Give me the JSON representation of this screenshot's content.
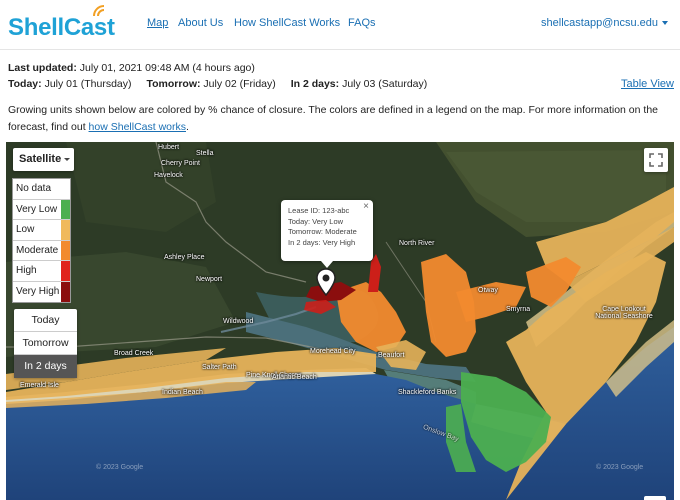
{
  "brand": {
    "name": "ShellCast"
  },
  "nav": {
    "links": [
      "Map",
      "About Us",
      "How ShellCast Works",
      "FAQs"
    ],
    "user": "shellcastapp@ncsu.edu"
  },
  "status": {
    "last_updated_label": "Last updated:",
    "last_updated_value": "July 01, 2021 09:48 AM (4 hours ago)",
    "today_label": "Today:",
    "today_value": "July 01 (Thursday)",
    "tomorrow_label": "Tomorrow:",
    "tomorrow_value": "July 02 (Friday)",
    "in2days_label": "In 2 days:",
    "in2days_value": "July 03 (Saturday)",
    "table_view": "Table View"
  },
  "description": {
    "text": "Growing units shown below are colored by % chance of closure. The colors are defined in a legend on the map. For more information on the forecast, find out ",
    "link": "how ShellCast works",
    "end": "."
  },
  "map": {
    "map_type": "Satellite",
    "legend": [
      {
        "label": "No data",
        "color": "#ffffff"
      },
      {
        "label": "Very Low",
        "color": "#4caf50"
      },
      {
        "label": "Low",
        "color": "#f0b95b"
      },
      {
        "label": "Moderate",
        "color": "#f28a2e"
      },
      {
        "label": "High",
        "color": "#e0231c"
      },
      {
        "label": "Very High",
        "color": "#8b0e0e"
      }
    ],
    "day_buttons": [
      "Today",
      "Tomorrow",
      "In 2 days"
    ],
    "active_day": "In 2 days",
    "popup": {
      "lease": "Lease ID: 123-abc",
      "today": "Today: Very Low",
      "tomorrow": "Tomorrow: Moderate",
      "in2days": "In 2 days: Very High",
      "close": "×"
    },
    "place_labels": [
      "Hubert",
      "Stella",
      "Cherry Point",
      "Havelock",
      "North River",
      "Otway",
      "Smyrna",
      "Ashley Place",
      "Newport",
      "Wildwood",
      "Morehead City",
      "Beaufort",
      "Broad Creek",
      "Pine Knoll Shores",
      "Atlantic Beach",
      "Indian Beach",
      "Emerald Isle",
      "Salter Path",
      "Shackleford Banks",
      "Cape Lookout National Seashore",
      "Onslow Bay"
    ],
    "watermark": "© 2023 Google"
  }
}
